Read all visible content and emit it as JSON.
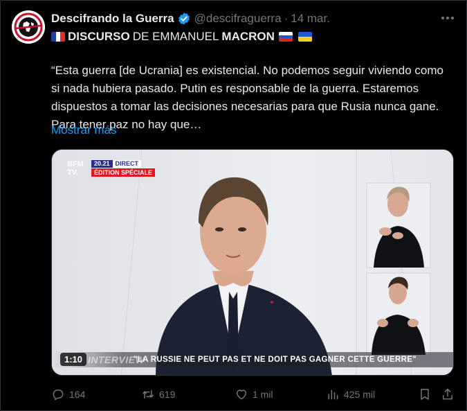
{
  "author": {
    "name": "Descifrando la Guerra",
    "handle": "@descifraguerra",
    "separator": "·",
    "date": "14 mar."
  },
  "headline": {
    "part1": "DISCURSO",
    "part2": "DE EMMANUEL",
    "part3": "MACRON"
  },
  "body": "“Esta guerra [de Ucrania] es existencial. No podemos seguir viviendo como\nsi nada hubiera pasado. Putin es responsable de la guerra. Estaremos\ndispuestos a tomar las decisiones necesarias para que Rusia nunca gane.\nPara tener paz no hay que…",
  "show_more": "Mostrar más",
  "video": {
    "channel_logo": "BFM TV.",
    "time": "20.21",
    "live_label": "DIRECT",
    "edition": "ÉDITION SPÉCIALE",
    "ticker_tag": "INTERVIEW",
    "ticker_text": "\"LA RUSSIE NE PEUT PAS ET NE DOIT PAS GAGNER CETTE GUERRE\"",
    "duration": "1:10"
  },
  "actions": {
    "replies": "164",
    "reposts": "619",
    "likes": "1 mil",
    "views": "425 mil"
  },
  "colors": {
    "accent": "#1d9bf0",
    "muted": "#71767b",
    "text": "#e7e9ea",
    "background": "#000000"
  },
  "icons": [
    "avatar-logo",
    "verified-badge-icon",
    "more-icon",
    "france-flag",
    "russia-flag",
    "ukraine-flag",
    "reply-icon",
    "repost-icon",
    "like-icon",
    "views-icon",
    "bookmark-icon",
    "share-icon"
  ]
}
